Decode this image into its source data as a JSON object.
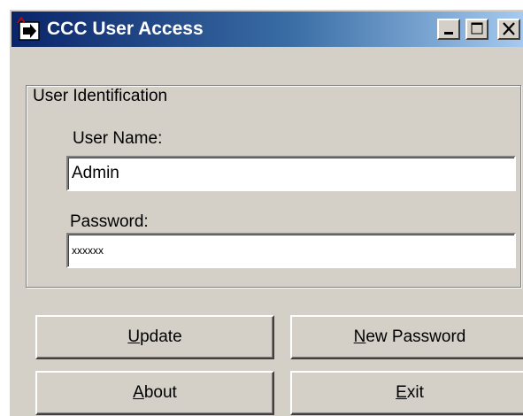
{
  "window": {
    "title": "CCC User Access",
    "controls": {
      "minimize_icon": "minimize-icon",
      "maximize_icon": "maximize-icon",
      "close_icon": "close-icon"
    }
  },
  "group": {
    "legend": "User Identification",
    "user_name": {
      "label": "User Name:",
      "value": "Admin"
    },
    "password": {
      "label": "Password:",
      "value": "xxxxxx"
    }
  },
  "buttons": {
    "update": {
      "mnemonic": "U",
      "rest": "pdate"
    },
    "new_password": {
      "mnemonic": "N",
      "rest": "ew Password"
    },
    "about": {
      "mnemonic": "A",
      "rest": "bout"
    },
    "exit": {
      "mnemonic": "E",
      "rest": "xit"
    }
  },
  "colors": {
    "titlebar_start": "#0a246a",
    "titlebar_end": "#a6caf0",
    "face": "#d4d0c8"
  }
}
